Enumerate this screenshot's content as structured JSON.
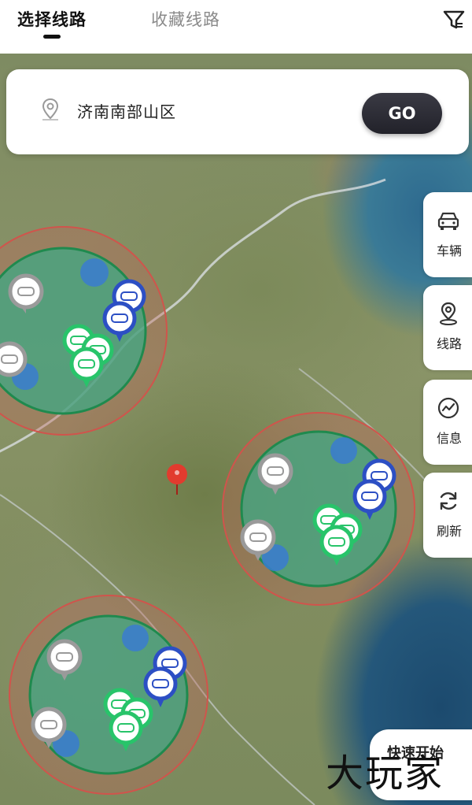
{
  "tabs": {
    "active_label": "选择线路",
    "inactive_label": "收藏线路"
  },
  "icons": {
    "filter": "filter-icon",
    "location_pin": "location-pin-icon",
    "car": "car-icon",
    "route": "route-icon",
    "info": "info-icon",
    "refresh": "refresh-icon"
  },
  "search": {
    "location_text": "济南南部山区",
    "go_label": "GO"
  },
  "side_buttons": [
    {
      "label": "车辆",
      "icon": "car-icon"
    },
    {
      "label": "线路",
      "icon": "route-icon"
    },
    {
      "label": "信息",
      "icon": "info-icon"
    },
    {
      "label": "刷新",
      "icon": "refresh-icon"
    }
  ],
  "bottom_card": {
    "label": "快速开始"
  },
  "watermark": "大玩家",
  "colors": {
    "marker_blue": "#2c4fc4",
    "marker_green": "#28c46a",
    "marker_gray": "#9a9a9a",
    "center_pin_red": "#e23b2e",
    "zone_green": "#2f9a6a",
    "zone_red_ring": "#c84a4a",
    "go_button": "#2a2a32"
  }
}
